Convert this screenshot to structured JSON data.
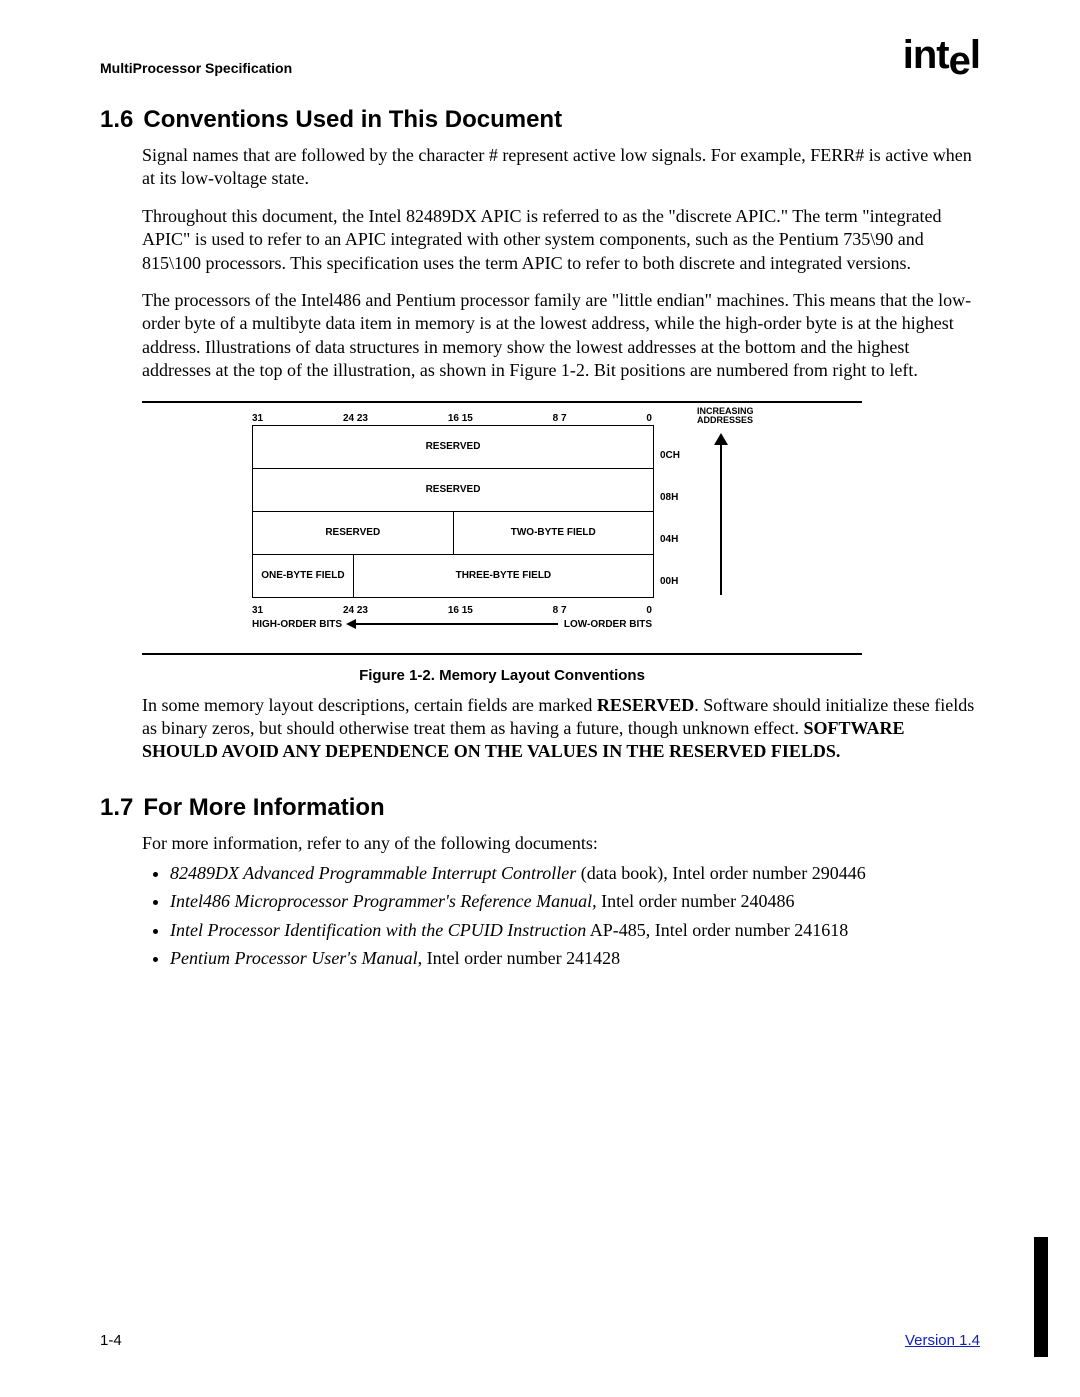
{
  "header": {
    "doc_title": "MultiProcessor Specification",
    "logo_text": "intel"
  },
  "section1": {
    "number": "1.6",
    "title": "Conventions Used in This Document",
    "p1": "Signal names that are followed by the character # represent active low signals.  For example, FERR# is active when at its low-voltage state.",
    "p2": "Throughout this document, the Intel 82489DX APIC is referred to as the \"discrete APIC.\" The term \"integrated APIC\" is used to refer to an APIC integrated with other system components, such as the Pentium 735\\90 and 815\\100 processors.  This specification uses the term APIC to refer to both discrete and integrated versions.",
    "p3": "The processors of the Intel486 and Pentium processor family are \"little endian\" machines.  This means that the low-order byte of a multibyte data item in memory is at the lowest address, while the high-order byte is at the highest address.  Illustrations of data structures in memory show the lowest addresses at the bottom and the highest addresses at the top of the illustration, as shown in Figure 1-2.  Bit positions are numbered from right to left."
  },
  "figure": {
    "caption": "Figure 1-2.  Memory Layout Conventions",
    "top_bits": [
      "31",
      "24  23",
      "16  15",
      "8   7",
      "0"
    ],
    "bot_bits": [
      "31",
      "24  23",
      "16  15",
      "8   7",
      "0"
    ],
    "rows": {
      "r0_c0": "RESERVED",
      "r1_c0": "RESERVED",
      "r2_c0": "RESERVED",
      "r2_c1": "TWO-BYTE FIELD",
      "r3_c0": "ONE-BYTE FIELD",
      "r3_c1": "THREE-BYTE FIELD"
    },
    "addrs": [
      "0CH",
      "08H",
      "04H",
      "00H"
    ],
    "inc_label_l1": "INCREASING",
    "inc_label_l2": "ADDRESSES",
    "high_order": "HIGH-ORDER BITS",
    "low_order": "LOW-ORDER BITS"
  },
  "after_fig": {
    "p1_a": "In some memory layout descriptions, certain fields are marked ",
    "p1_reserved": "RESERVED",
    "p1_b": ".  Software should initialize these fields as binary zeros, but should otherwise treat them as having a future, though unknown effect.  ",
    "p1_bold": "SOFTWARE SHOULD AVOID ANY DEPENDENCE ON THE VALUES IN THE RESERVED FIELDS."
  },
  "section2": {
    "number": "1.7",
    "title": "For More Information",
    "intro": "For more information, refer to any of the following documents:",
    "items": [
      {
        "em": "82489DX Advanced Programmable Interrupt Controller",
        "rest": " (data book), Intel order number 290446"
      },
      {
        "em": "Intel486 Microprocessor Programmer's Reference Manual,",
        "rest": " Intel order number 240486"
      },
      {
        "em": "Intel Processor Identification with the CPUID Instruction",
        "rest": " AP-485, Intel order number 241618"
      },
      {
        "em": "Pentium Processor User's Manual",
        "rest": ", Intel order number 241428"
      }
    ]
  },
  "footer": {
    "page": "1-4",
    "version": "Version 1.4"
  }
}
